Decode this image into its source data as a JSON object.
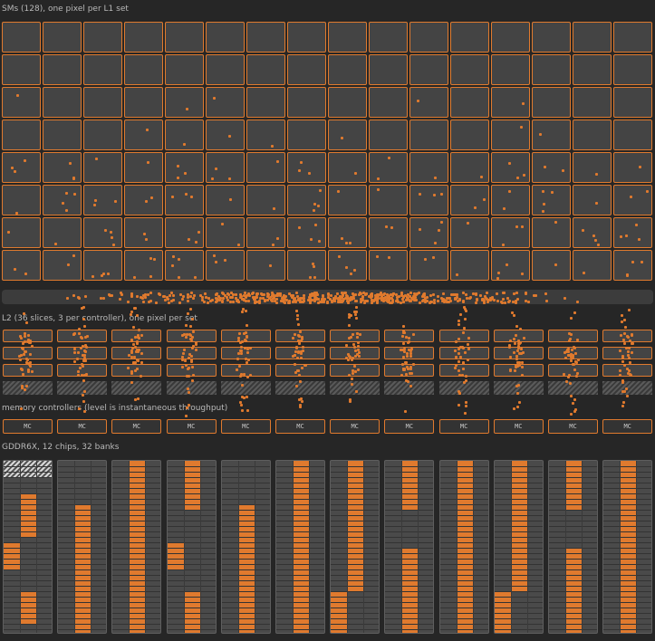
{
  "labels": {
    "sms": "SMs (128), one pixel per L1 set",
    "l2": "L2 (36 slices, 3 per controller), one pixel per set",
    "mc": "memory controllers (level is instantaneous throughput)",
    "dram": "GDDR6X, 12 chips, 32 banks"
  },
  "mc_label": "MC",
  "counts": {
    "sms": 128,
    "l2_slices": 36,
    "controllers": 12,
    "chips": 12,
    "banks_per_chip": 32
  },
  "colors": {
    "accent": "#e07a2e",
    "background": "#262626",
    "cell": "#444444"
  },
  "controllers": [
    {
      "id": "mc-0",
      "label": "MC"
    },
    {
      "id": "mc-1",
      "label": "MC"
    },
    {
      "id": "mc-2",
      "label": "MC"
    },
    {
      "id": "mc-3",
      "label": "MC"
    },
    {
      "id": "mc-4",
      "label": "MC"
    },
    {
      "id": "mc-5",
      "label": "MC"
    },
    {
      "id": "mc-6",
      "label": "MC"
    },
    {
      "id": "mc-7",
      "label": "MC"
    },
    {
      "id": "mc-8",
      "label": "MC"
    },
    {
      "id": "mc-9",
      "label": "MC"
    },
    {
      "id": "mc-10",
      "label": "MC"
    },
    {
      "id": "mc-11",
      "label": "MC"
    }
  ],
  "chip_bank_activity": [
    [
      [
        0,
        2,
        "hatch"
      ],
      [
        6,
        13,
        "right"
      ],
      [
        15,
        19,
        "left"
      ],
      [
        24,
        29,
        "right"
      ]
    ],
    [
      [
        8,
        31,
        "right"
      ]
    ],
    [
      [
        0,
        31,
        "center"
      ]
    ],
    [
      [
        0,
        8,
        "right"
      ],
      [
        15,
        19,
        "left"
      ],
      [
        24,
        31,
        "right"
      ]
    ],
    [
      [
        8,
        31,
        "center"
      ]
    ],
    [
      [
        0,
        31,
        "center"
      ]
    ],
    [
      [
        0,
        23,
        "right"
      ],
      [
        24,
        31,
        "left"
      ]
    ],
    [
      [
        0,
        8,
        "center"
      ],
      [
        16,
        31,
        "center"
      ]
    ],
    [
      [
        0,
        31,
        "center"
      ]
    ],
    [
      [
        0,
        23,
        "right"
      ],
      [
        24,
        31,
        "left"
      ]
    ],
    [
      [
        0,
        8,
        "center"
      ],
      [
        16,
        31,
        "center"
      ]
    ],
    [
      [
        0,
        31,
        "center"
      ]
    ]
  ]
}
